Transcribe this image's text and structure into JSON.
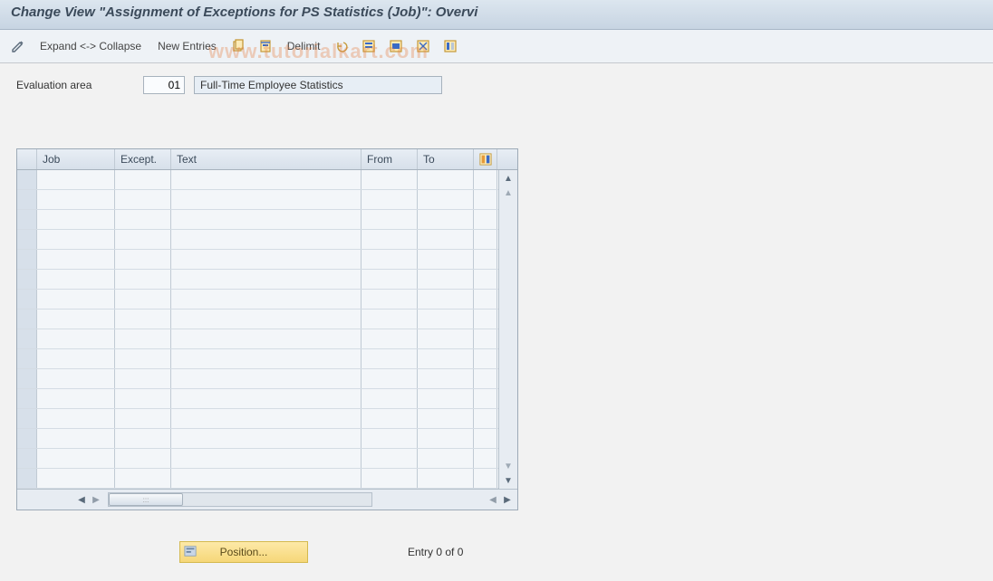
{
  "title": "Change View \"Assignment of Exceptions for PS Statistics (Job)\": Overvi",
  "watermark": "www.tutorialkart.com",
  "toolbar": {
    "expand_collapse": "Expand <-> Collapse",
    "new_entries": "New Entries",
    "delimit": "Delimit"
  },
  "fields": {
    "eval_area_label": "Evaluation area",
    "eval_area_code": "01",
    "eval_area_text": "Full-Time Employee Statistics"
  },
  "grid": {
    "columns": {
      "job": "Job",
      "except": "Except.",
      "text": "Text",
      "from": "From",
      "to": "To"
    },
    "row_count": 16
  },
  "footer": {
    "position_label": "Position...",
    "entry_text": "Entry 0 of 0"
  }
}
